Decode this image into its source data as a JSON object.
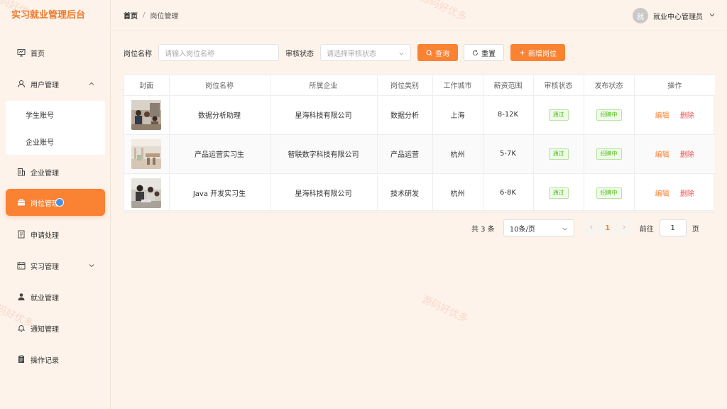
{
  "app": {
    "title": "实习就业管理后台"
  },
  "sidebar": {
    "items": [
      {
        "label": "首页",
        "icon": "monitor-icon"
      },
      {
        "label": "用户管理",
        "icon": "user-icon",
        "expanded": true
      },
      {
        "label": "企业管理",
        "icon": "building-icon"
      },
      {
        "label": "岗位管理",
        "icon": "briefcase-icon",
        "active": true
      },
      {
        "label": "申请处理",
        "icon": "document-icon"
      },
      {
        "label": "实习管理",
        "icon": "calendar-icon",
        "collapsed": true
      },
      {
        "label": "就业管理",
        "icon": "person-icon"
      },
      {
        "label": "通知管理",
        "icon": "bell-icon"
      },
      {
        "label": "操作记录",
        "icon": "clipboard-icon"
      }
    ],
    "submenu": [
      {
        "label": "学生账号"
      },
      {
        "label": "企业账号"
      }
    ]
  },
  "header": {
    "breadcrumb": {
      "home": "首页",
      "current": "岗位管理"
    },
    "user": {
      "avatar_text": "就",
      "name": "就业中心管理员"
    }
  },
  "search": {
    "name_label": "岗位名称",
    "name_placeholder": "请输入岗位名称",
    "status_label": "审核状态",
    "status_placeholder": "请选择审核状态",
    "query_label": "查询",
    "reset_label": "重置",
    "add_label": "新增岗位"
  },
  "table": {
    "columns": [
      "封面",
      "岗位名称",
      "所属企业",
      "岗位类别",
      "工作城市",
      "薪资范围",
      "审核状态",
      "发布状态",
      "操作"
    ],
    "rows": [
      {
        "name": "数据分析助理",
        "company": "星海科技有限公司",
        "category": "数据分析",
        "city": "上海",
        "salary": "8-12K",
        "audit": "通过",
        "publish": "招聘中",
        "edit": "编辑",
        "delete": "删除"
      },
      {
        "name": "产品运营实习生",
        "company": "智联数字科技有限公司",
        "category": "产品运营",
        "city": "杭州",
        "salary": "5-7K",
        "audit": "通过",
        "publish": "招聘中",
        "edit": "编辑",
        "delete": "删除"
      },
      {
        "name": "Java 开发实习生",
        "company": "星海科技有限公司",
        "category": "技术研发",
        "city": "杭州",
        "salary": "6-8K",
        "audit": "通过",
        "publish": "招聘中",
        "edit": "编辑",
        "delete": "删除"
      }
    ]
  },
  "pagination": {
    "total": "共 3 条",
    "page_size": "10条/页",
    "current_page": "1",
    "goto_label": "前往",
    "goto_value": "1",
    "goto_unit": "页"
  },
  "watermark": "源码好优多",
  "colors": {
    "accent": "#fa8233",
    "success": "#52c41a",
    "danger": "#f04b4b"
  }
}
